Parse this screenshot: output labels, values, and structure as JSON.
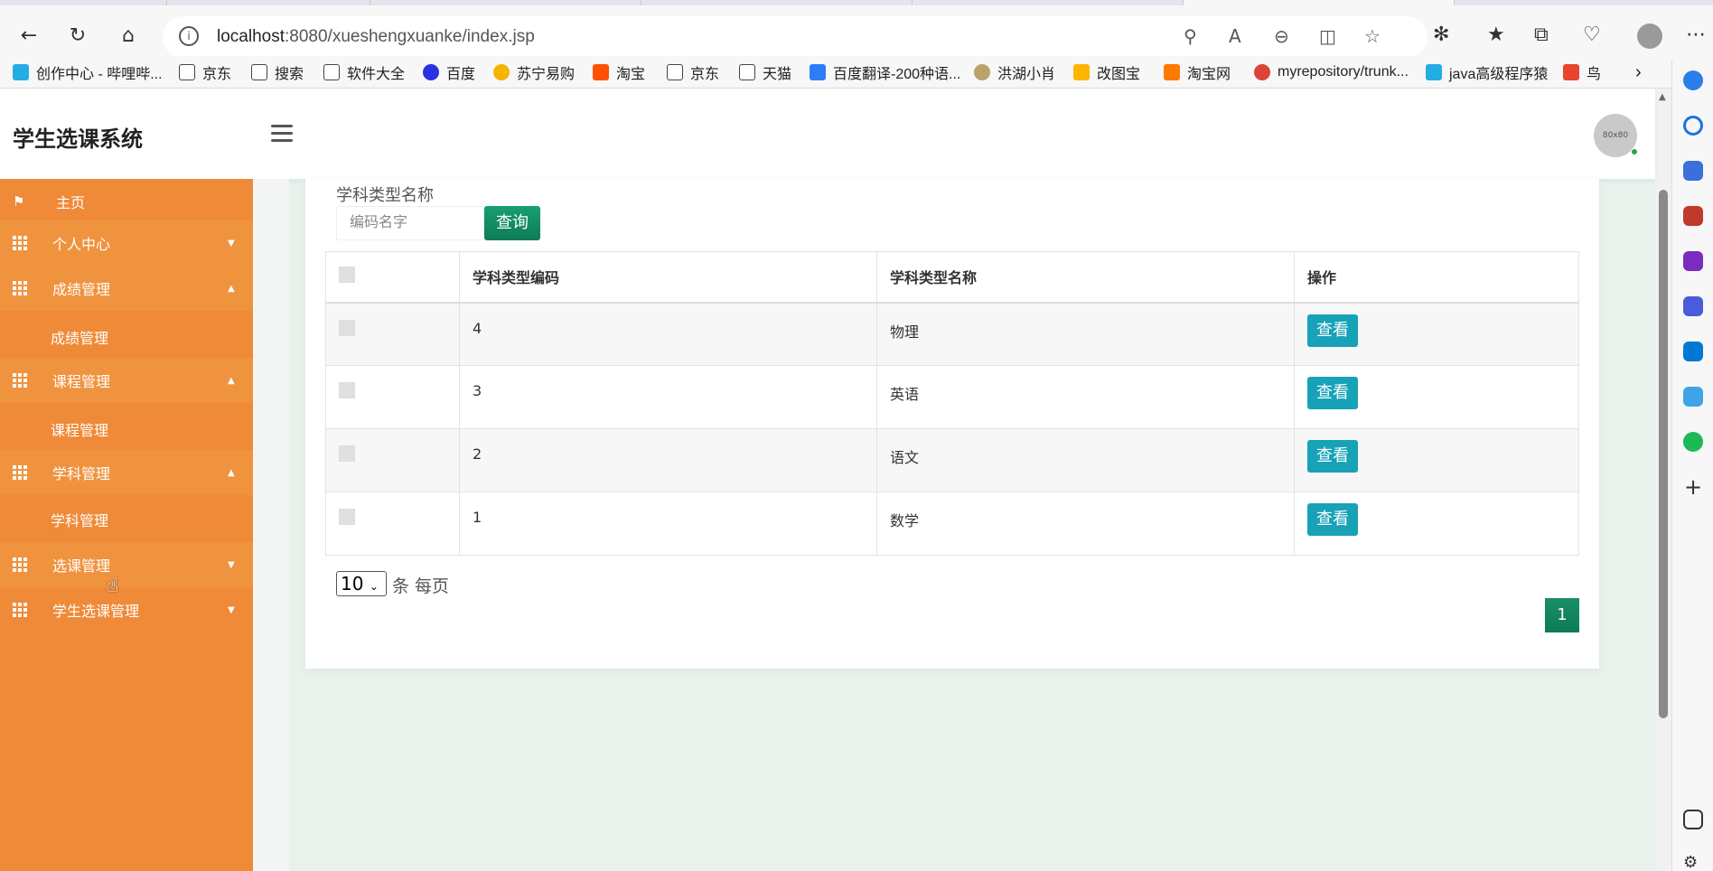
{
  "browser": {
    "url_host": "localhost",
    "url_path": ":8080/xueshengxuanke/index.jsp",
    "bookmarks": [
      "创作中心 - 哔哩哔...",
      "京东",
      "搜索",
      "软件大全",
      "百度",
      "苏宁易购",
      "淘宝",
      "京东",
      "天猫",
      "百度翻译-200种语...",
      "洪湖小肖",
      "改图宝",
      "淘宝网",
      "myrepository/trunk...",
      "java高级程序猿",
      "鸟"
    ]
  },
  "header": {
    "app_title": "学生选课系统",
    "avatar_text": "80x80"
  },
  "sidebar": {
    "items": [
      {
        "label": "主页"
      },
      {
        "label": "个人中心"
      },
      {
        "label": "成绩管理"
      },
      {
        "label": "成绩管理"
      },
      {
        "label": "课程管理"
      },
      {
        "label": "课程管理"
      },
      {
        "label": "学科管理"
      },
      {
        "label": "学科管理"
      },
      {
        "label": "选课管理"
      },
      {
        "label": "学生选课管理"
      }
    ]
  },
  "search": {
    "label": "学科类型名称",
    "placeholder": "编码名字",
    "button": "查询"
  },
  "table": {
    "headers": [
      "学科类型编码",
      "学科类型名称",
      "操作"
    ],
    "rows": [
      {
        "code": "4",
        "name": "物理",
        "action": "查看"
      },
      {
        "code": "3",
        "name": "英语",
        "action": "查看"
      },
      {
        "code": "2",
        "name": "语文",
        "action": "查看"
      },
      {
        "code": "1",
        "name": "数学",
        "action": "查看"
      }
    ]
  },
  "pager": {
    "page_size": "10",
    "per_page_text": "条 每页",
    "current_page": "1"
  },
  "colors": {
    "sidebar": "#ef8a38",
    "primary_green": "#0f7a57",
    "info_teal": "#17a2b8"
  }
}
